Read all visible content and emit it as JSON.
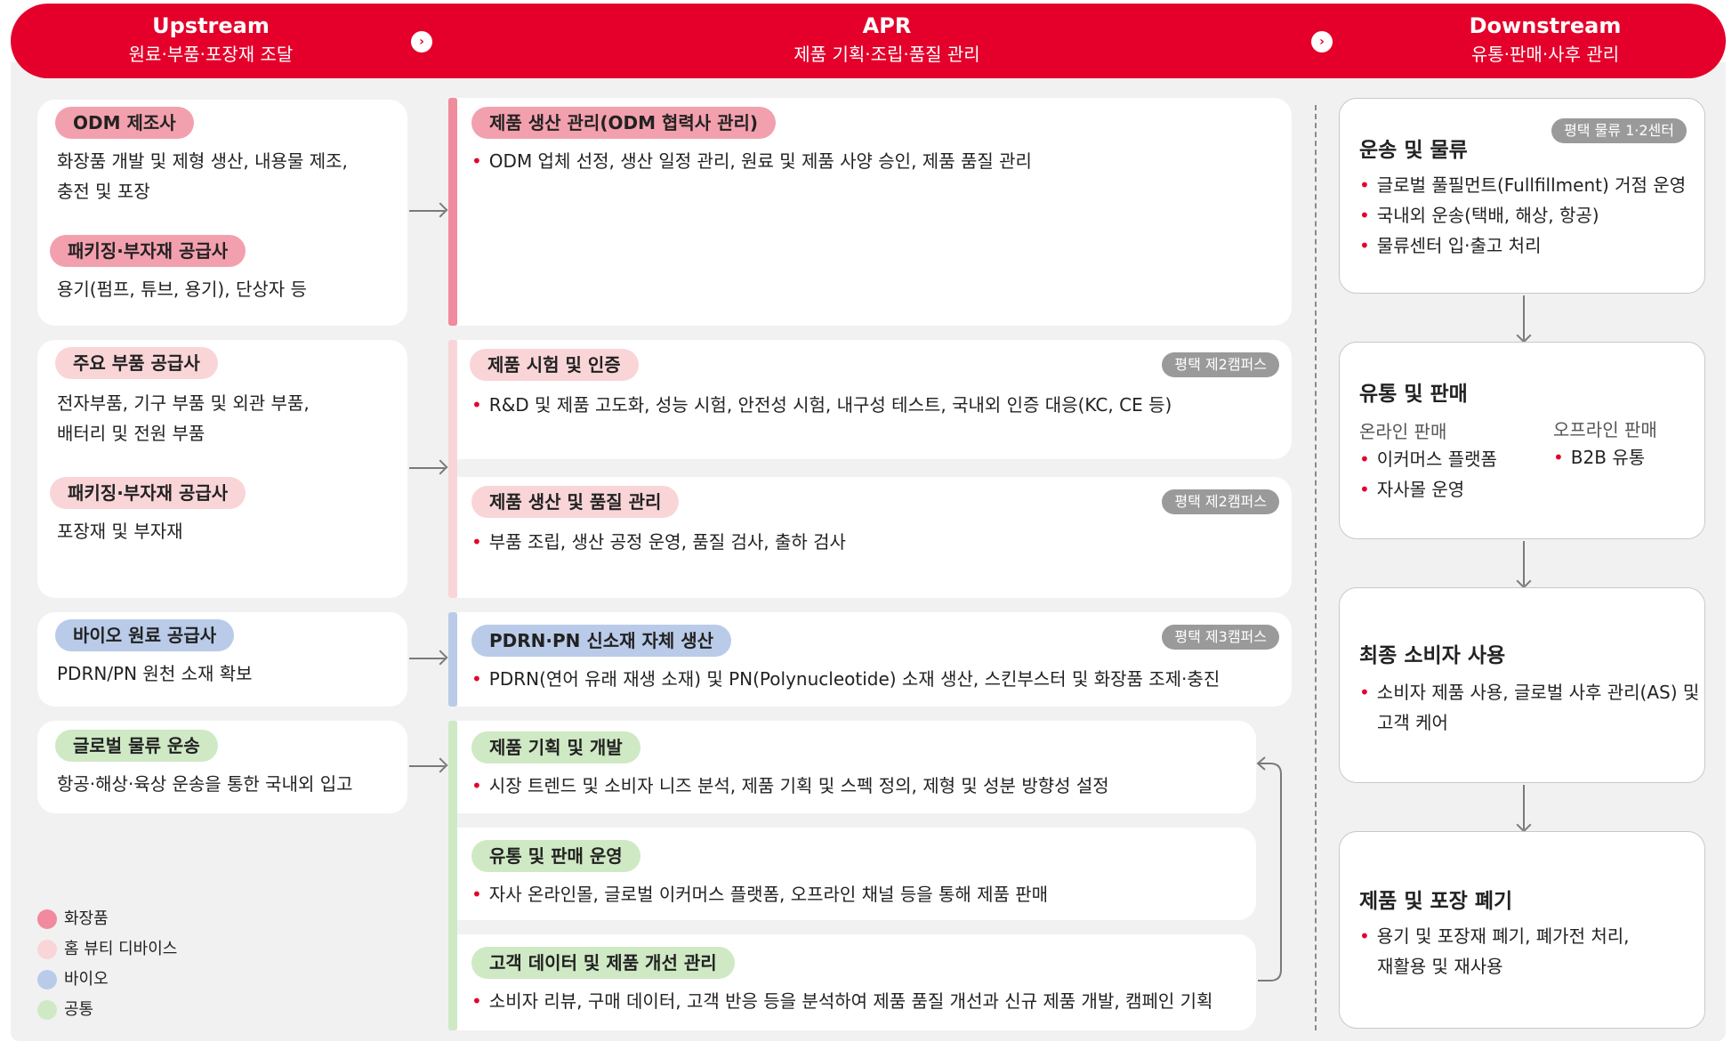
{
  "colors": {
    "accent": "#e4002b",
    "cosmetics": "#f08a9c",
    "home_beauty": "#f9d5d8",
    "bio": "#b9cbe8",
    "common": "#cfe9c4"
  },
  "header": {
    "upstream": {
      "title": "Upstream",
      "subtitle": "원료·부품·포장재 조달"
    },
    "apr": {
      "title": "APR",
      "subtitle": "제품 기획·조립·품질 관리"
    },
    "downstream": {
      "title": "Downstream",
      "subtitle": "유통·판매·사후 관리"
    }
  },
  "upstream": {
    "c1": {
      "p1": "ODM 제조사",
      "t1a": "화장품 개발 및 제형 생산, 내용물 제조,",
      "t1b": "충전 및 포장",
      "p2": "패키징·부자재 공급사",
      "t2": "용기(펌프, 튜브, 용기), 단상자 등"
    },
    "c2": {
      "p1": "주요 부품 공급사",
      "t1a": "전자부품, 기구 부품 및 외관 부품,",
      "t1b": "배터리 및 전원 부품",
      "p2": "패키징·부자재 공급사",
      "t2": "포장재 및 부자재"
    },
    "c3": {
      "p1": "바이오 원료 공급사",
      "t1": "PDRN/PN 원천 소재 확보"
    },
    "c4": {
      "p1": "글로벌 물류 운송",
      "t1": "항공·해상·육상 운송을 통한 국내외 입고"
    }
  },
  "apr": {
    "a1": {
      "pill": "제품 생산 관리(ODM 협력사 관리)",
      "b1": "ODM 업체 선정, 생산 일정 관리, 원료 및 제품 사양 승인, 제품 품질 관리"
    },
    "a2": {
      "pill": "제품 시험 및 인증",
      "loc": "평택 제2캠퍼스",
      "b1": "R&D 및 제품 고도화, 성능 시험, 안전성 시험, 내구성 테스트, 국내외 인증 대응(KC, CE 등)"
    },
    "a3": {
      "pill": "제품 생산 및 품질 관리",
      "loc": "평택 제2캠퍼스",
      "b1": "부품 조립, 생산 공정 운영, 품질 검사, 출하 검사"
    },
    "a4": {
      "pill": "PDRN·PN 신소재 자체 생산",
      "loc": "평택 제3캠퍼스",
      "b1": "PDRN(연어 유래 재생 소재) 및 PN(Polynucleotide) 소재 생산, 스킨부스터 및 화장품 조제·충진"
    },
    "a5": {
      "pill": "제품 기획 및 개발",
      "b1": "시장 트렌드 및 소비자 니즈 분석, 제품 기획 및 스펙 정의, 제형 및 성분 방향성 설정"
    },
    "a6": {
      "pill": "유통 및 판매 운영",
      "b1": "자사 온라인몰, 글로벌 이커머스 플랫폼, 오프라인 채널 등을 통해 제품 판매"
    },
    "a7": {
      "pill": "고객 데이터 및 제품 개선 관리",
      "b1": "소비자 리뷰, 구매 데이터, 고객 반응 등을 분석하여 제품 품질 개선과 신규 제품 개발, 캠페인 기획"
    }
  },
  "downstream": {
    "d1": {
      "title": "운송 및 물류",
      "loc": "평택 물류 1·2센터",
      "b1": "글로벌 풀필먼트(Fullfillment) 거점 운영",
      "b2": "국내외 운송(택배, 해상, 항공)",
      "b3": "물류센터 입·출고 처리"
    },
    "d2": {
      "title": "유통 및 판매",
      "online": "온라인 판매",
      "offline": "오프라인 판매",
      "b1": "이커머스 플랫폼",
      "b2": "자사몰 운영",
      "b3": "B2B 유통"
    },
    "d3": {
      "title": "최종 소비자 사용",
      "b1a": "소비자 제품 사용, 글로벌 사후 관리(AS) 및",
      "b1b": "고객 케어"
    },
    "d4": {
      "title": "제품 및 포장 폐기",
      "b1a": "용기 및 포장재 폐기, 폐가전 처리,",
      "b1b": "재활용 및 재사용"
    }
  },
  "legend": {
    "cosmetics": "화장품",
    "home_beauty": "홈 뷰티 디바이스",
    "bio": "바이오",
    "common": "공통"
  },
  "icons": {
    "chevron": "chevron-right-icon",
    "dot": "•"
  }
}
